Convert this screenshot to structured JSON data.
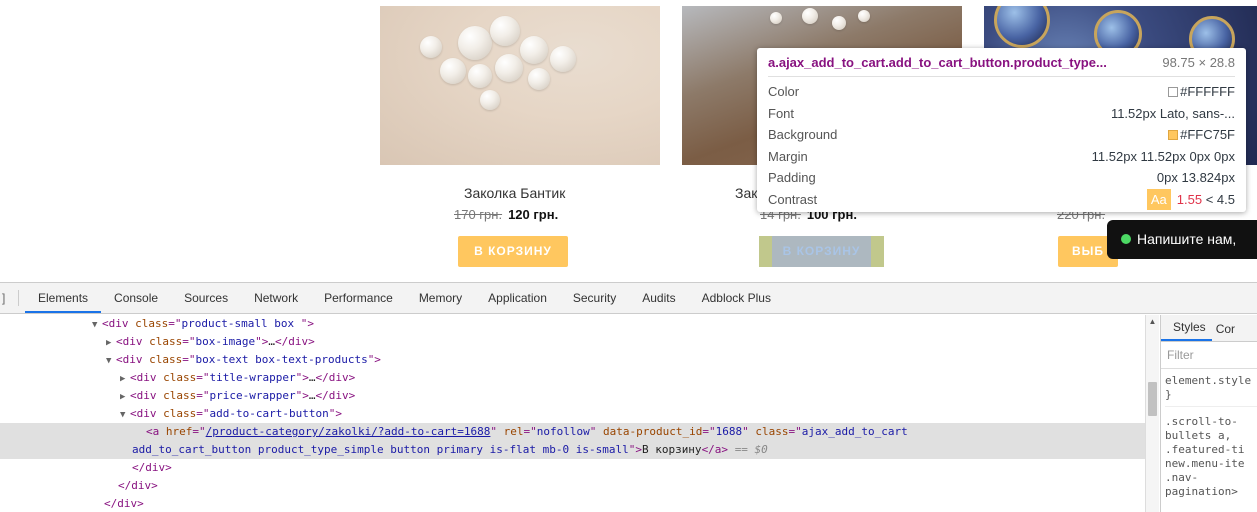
{
  "products": [
    {
      "title": "Заколка Бантик",
      "old_price": "170 грн.",
      "new_price": "120 грн.",
      "button": "В КОРЗИНУ"
    },
    {
      "title": "Зак",
      "old_price": "14 грн.",
      "new_price": "100 грн.",
      "button": "В КОРЗИНУ"
    },
    {
      "title": "",
      "old_price": "220 грн.",
      "new_price": "",
      "button": "ВЫБ"
    }
  ],
  "tooltip": {
    "selector": "a.ajax_add_to_cart.add_to_cart_button.product_type...",
    "dimensions": "98.75 × 28.8",
    "rows": [
      {
        "key": "Color",
        "value": "#FFFFFF",
        "swatch": "#FFFFFF"
      },
      {
        "key": "Font",
        "value": "11.52px Lato, sans-..."
      },
      {
        "key": "Background",
        "value": "#FFC75F",
        "swatch": "#FFC75F"
      },
      {
        "key": "Margin",
        "value": "11.52px 11.52px 0px 0px"
      },
      {
        "key": "Padding",
        "value": "0px 13.824px"
      },
      {
        "key": "Contrast",
        "badge": "Aa",
        "ratio": "1.55",
        "threshold": "< 4.5"
      }
    ]
  },
  "chat": {
    "label": "Напишите нам,"
  },
  "devtools": {
    "tabs": [
      "Elements",
      "Console",
      "Sources",
      "Network",
      "Performance",
      "Memory",
      "Application",
      "Security",
      "Audits",
      "Adblock Plus"
    ],
    "active_tab": "Elements",
    "dom": {
      "l1_class": "product-small box ",
      "l2_class": "box-image",
      "l3_class": "box-text box-text-products",
      "l4_class": "title-wrapper",
      "l5_class": "price-wrapper",
      "l6_class": "add-to-cart-button",
      "a_href": "/product-category/zakolki/?add-to-cart=1688",
      "a_rel": "nofollow",
      "a_pid": "1688",
      "a_class1": "ajax_add_to_cart",
      "a_class2": "add_to_cart_button product_type_simple button primary is-flat mb-0 is-small",
      "a_text": "В корзину",
      "a_marker": "== $0"
    },
    "styles_tabs": [
      "Styles",
      "Cor"
    ],
    "styles_filter": "Filter",
    "styles_code": [
      "element.style {",
      "}",
      ".scroll-to-",
      "bullets a,",
      ".featured-ti",
      "new.menu-ite",
      ".nav-",
      "pagination>"
    ]
  }
}
